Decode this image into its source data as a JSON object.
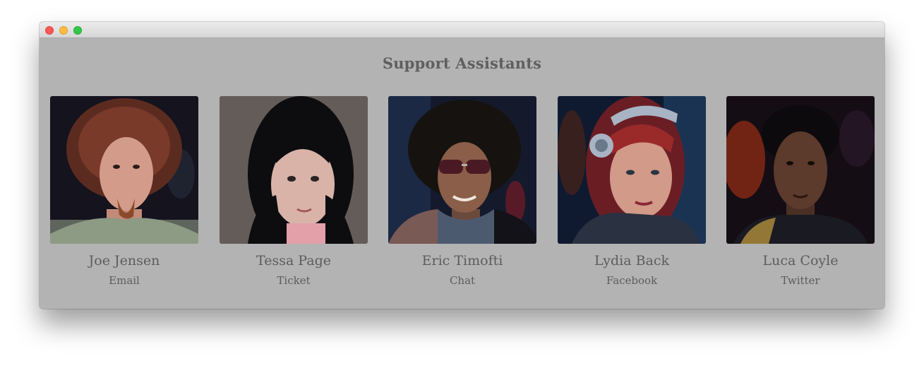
{
  "window": {
    "title_lights": [
      "close",
      "minimize",
      "zoom"
    ],
    "heading": "Support Assistants"
  },
  "assistants": [
    {
      "name": "Joe Jensen",
      "channel": "Email",
      "avatar": "portrait-man-red-hair"
    },
    {
      "name": "Tessa Page",
      "channel": "Ticket",
      "avatar": "portrait-woman-black-hair"
    },
    {
      "name": "Eric Timofti",
      "channel": "Chat",
      "avatar": "portrait-man-sunglasses"
    },
    {
      "name": "Lydia Back",
      "channel": "Facebook",
      "avatar": "portrait-woman-red-hair-headphones"
    },
    {
      "name": "Luca Coyle",
      "channel": "Twitter",
      "avatar": "portrait-young-man"
    }
  ],
  "colors": {
    "window_bg": "#b3b3b3",
    "text": "#5c5c5c",
    "close": "#fc5753",
    "minimize": "#fdbc40",
    "zoom": "#33c748"
  }
}
